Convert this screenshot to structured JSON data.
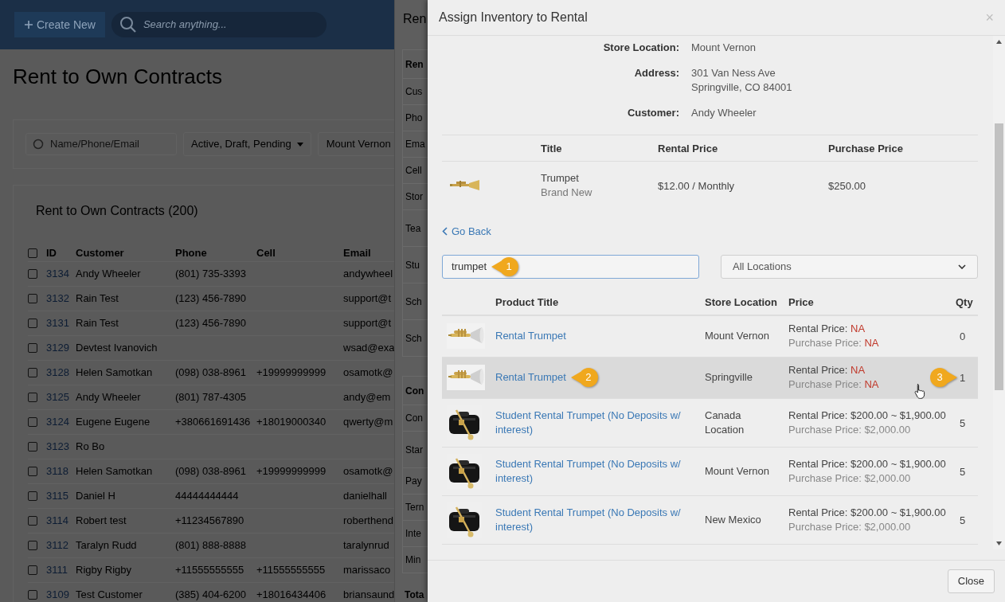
{
  "topbar": {
    "create_label": "Create New",
    "search_placeholder": "Search anything..."
  },
  "page_title": "Rent to Own Contracts",
  "filters": {
    "search_placeholder": "Name/Phone/Email",
    "status": "Active, Draft, Pending",
    "location": "Mount Vernon"
  },
  "contracts": {
    "title": "Rent to Own Contracts (200)",
    "select_all_checked": false,
    "columns": [
      "ID",
      "Customer",
      "Phone",
      "Cell",
      "Email"
    ],
    "rows": [
      {
        "id": "3134",
        "customer": "Andy Wheeler",
        "phone": "(801) 735-3393",
        "cell": "",
        "email": "andywheel",
        "checked": false
      },
      {
        "id": "3132",
        "customer": "Rain Test",
        "phone": "(123) 456-7890",
        "cell": "",
        "email": "support@t",
        "checked": false
      },
      {
        "id": "3131",
        "customer": "Rain Test",
        "phone": "(123) 456-7890",
        "cell": "",
        "email": "support@t",
        "checked": false
      },
      {
        "id": "3129",
        "customer": "Devtest Ivanovich",
        "phone": "",
        "cell": "",
        "email": "wsad@exa",
        "checked": false
      },
      {
        "id": "3128",
        "customer": "Helen Samotkan",
        "phone": "(098) 038-8961",
        "cell": "+19999999999",
        "email": "osamotk@",
        "checked": false
      },
      {
        "id": "3125",
        "customer": "Andy Wheeler",
        "phone": "(801) 787-4305",
        "cell": "",
        "email": "andy@em",
        "checked": false
      },
      {
        "id": "3124",
        "customer": "Eugene Eugene",
        "phone": "+380661691436",
        "cell": "+18019000340",
        "email": "qwerty@m",
        "checked": false
      },
      {
        "id": "3123",
        "customer": "Ro Bo",
        "phone": "",
        "cell": "",
        "email": "",
        "checked": false
      },
      {
        "id": "3118",
        "customer": "Helen Samotkan",
        "phone": "(098) 038-8961",
        "cell": "+19999999999",
        "email": "osamotk@",
        "checked": false
      },
      {
        "id": "3115",
        "customer": "Daniel H",
        "phone": "44444444444",
        "cell": "",
        "email": "danielhall",
        "checked": false
      },
      {
        "id": "3114",
        "customer": "Robert test",
        "phone": "+11234567890",
        "cell": "",
        "email": "roberthend",
        "checked": false
      },
      {
        "id": "3112",
        "customer": "Taralyn Rudd",
        "phone": "(801) 888-8888",
        "cell": "",
        "email": "taralynrud",
        "checked": false
      },
      {
        "id": "3111",
        "customer": "Rigby Rigby",
        "phone": "+11555555555",
        "cell": "+11555555555",
        "email": "marissaco",
        "checked": false
      },
      {
        "id": "3109",
        "customer": "Test Customer",
        "phone": "(385) 404-6200",
        "cell": "+18016434406",
        "email": "briansaund",
        "checked": false
      }
    ]
  },
  "drawer": {
    "title": "Ren",
    "sections": [
      {
        "items": [
          {
            "kind": "heading",
            "text": "Ren"
          },
          {
            "kind": "field",
            "text": "Cus"
          },
          {
            "kind": "field",
            "text": "Pho"
          },
          {
            "kind": "field",
            "text": "Ema"
          },
          {
            "kind": "field",
            "text": "Cell"
          },
          {
            "kind": "field",
            "text": "Stor"
          },
          {
            "kind": "tall",
            "text": "Tea"
          },
          {
            "kind": "tall",
            "text": "Stu"
          },
          {
            "kind": "tall",
            "text": "Sch"
          },
          {
            "kind": "tall",
            "text": "Sch"
          }
        ]
      },
      {
        "items": [
          {
            "kind": "heading",
            "text": "Con"
          },
          {
            "kind": "field",
            "text": "Con"
          },
          {
            "kind": "tall",
            "text": "Star"
          },
          {
            "kind": "field",
            "text": "Pay"
          },
          {
            "kind": "field",
            "text": "Tern"
          },
          {
            "kind": "field",
            "text": "Inte"
          },
          {
            "kind": "field",
            "text": "Min"
          }
        ]
      }
    ],
    "total": "Tota"
  },
  "modal": {
    "title": "Assign Inventory to Rental",
    "close_symbol": "×",
    "info": [
      {
        "label": "Store Location:",
        "lines": [
          "Mount Vernon"
        ]
      },
      {
        "label": "Address:",
        "lines": [
          "301 Van Ness Ave",
          "Springville, CO 84001"
        ]
      },
      {
        "label": "Customer:",
        "lines": [
          "Andy Wheeler"
        ]
      }
    ],
    "rental_item": {
      "columns": [
        "Title",
        "Rental Price",
        "Purchase Price"
      ],
      "title": "Trumpet",
      "condition": "Brand New",
      "rental_price": "$12.00 / Monthly",
      "purchase_price": "$250.00"
    },
    "go_back": "Go Back",
    "search": {
      "value": "trumpet",
      "callout": "1"
    },
    "location_select": "All Locations",
    "products": {
      "columns": [
        "Product Title",
        "Store Location",
        "Price",
        "Qty"
      ],
      "rows": [
        {
          "kind": "loose",
          "title": "Rental Trumpet",
          "location": "Mount Vernon",
          "rental_label": "Rental Price:",
          "rental_value": "NA",
          "purchase_label": "Purchase Price:",
          "purchase_value": "NA",
          "price_available": false,
          "qty": "0",
          "highlighted": false,
          "cursor": false
        },
        {
          "kind": "loose",
          "title": "Rental Trumpet",
          "location": "Springville",
          "rental_label": "Rental Price:",
          "rental_value": "NA",
          "purchase_label": "Purchase Price:",
          "purchase_value": "NA",
          "price_available": false,
          "qty": "1",
          "highlighted": true,
          "cursor": true,
          "title_callout": "2",
          "qty_callout": "3"
        },
        {
          "kind": "cased",
          "title": "Student Rental Trumpet (No Deposits w/ interest)",
          "location": "Canada Location",
          "rental_label": "Rental Price:",
          "rental_value": "$200.00 ~ $1,900.00",
          "purchase_label": "Purchase Price:",
          "purchase_value": "$2,000.00",
          "price_available": true,
          "qty": "5",
          "highlighted": false,
          "cursor": false
        },
        {
          "kind": "cased",
          "title": "Student Rental Trumpet (No Deposits w/ interest)",
          "location": "Mount Vernon",
          "rental_label": "Rental Price:",
          "rental_value": "$200.00 ~ $1,900.00",
          "purchase_label": "Purchase Price:",
          "purchase_value": "$2,000.00",
          "price_available": true,
          "qty": "5",
          "highlighted": false,
          "cursor": false
        },
        {
          "kind": "cased",
          "title": "Student Rental Trumpet (No Deposits w/ interest)",
          "location": "New Mexico",
          "rental_label": "Rental Price:",
          "rental_value": "$200.00 ~ $1,900.00",
          "purchase_label": "Purchase Price:",
          "purchase_value": "$2,000.00",
          "price_available": true,
          "qty": "5",
          "highlighted": false,
          "cursor": false
        }
      ]
    },
    "close_button": "Close"
  }
}
